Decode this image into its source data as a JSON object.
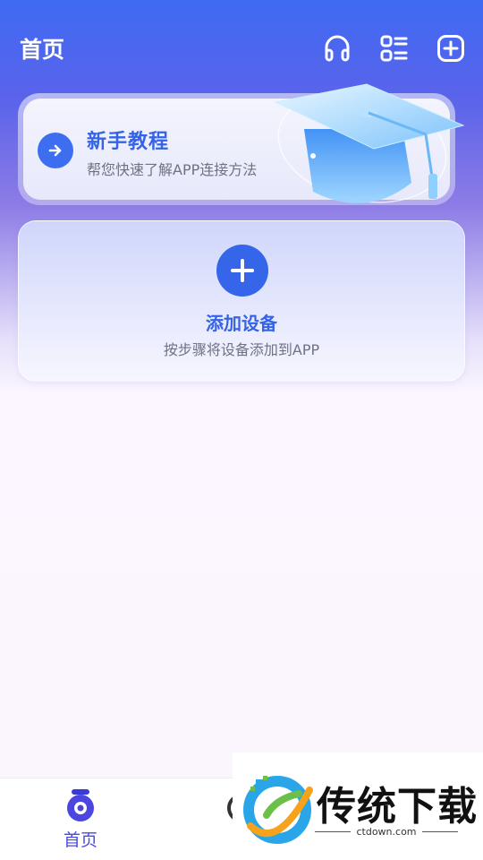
{
  "header": {
    "title": "首页",
    "icons": [
      "headset-icon",
      "list-icon",
      "add-square-icon"
    ]
  },
  "tutorial": {
    "title": "新手教程",
    "subtitle": "帮您快速了解APP连接方法",
    "icon": "arrow-right-icon",
    "image": "graduation-cap-illustration"
  },
  "add_device": {
    "title": "添加设备",
    "subtitle": "按步骤将设备添加到APP",
    "icon": "plus-icon"
  },
  "tabbar": {
    "tabs": [
      {
        "label": "首页",
        "icon": "camera-icon",
        "active": true
      },
      {
        "label": "消",
        "icon": "message-icon",
        "active": false
      }
    ]
  },
  "watermark": {
    "brand": "传统下载",
    "url": "ctdown.com"
  },
  "colors": {
    "primary": "#3565e8",
    "header_bg": "#3f6af4",
    "page_bg": "#fbf5fe"
  }
}
